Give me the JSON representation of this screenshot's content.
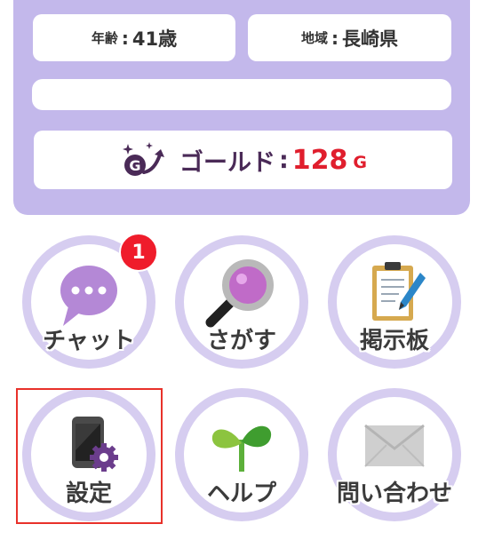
{
  "profile": {
    "age": {
      "label": "年齢",
      "separator": ":",
      "value": "41歳"
    },
    "area": {
      "label": "地域",
      "separator": ":",
      "value": "長崎県"
    },
    "gold": {
      "icon": "gold-coin-icon",
      "label": "ゴールド",
      "separator": ":",
      "value": "128",
      "unit": "G"
    }
  },
  "menu": {
    "chat": {
      "label": "チャット",
      "badge": "1",
      "icon": "speech-bubble-icon"
    },
    "search": {
      "label": "さがす",
      "icon": "magnifier-icon"
    },
    "board": {
      "label": "掲示板",
      "icon": "clipboard-pencil-icon"
    },
    "settings": {
      "label": "設定",
      "icon": "phone-gear-icon"
    },
    "help": {
      "label": "ヘルプ",
      "icon": "sprout-icon"
    },
    "contact": {
      "label": "問い合わせ",
      "icon": "envelope-icon"
    }
  },
  "colors": {
    "panel": "#c3b8eb",
    "ring": "#d6cdf0",
    "gold_value": "#e01e2d",
    "badge": "#ef1c2b",
    "highlight": "#e8312a"
  }
}
